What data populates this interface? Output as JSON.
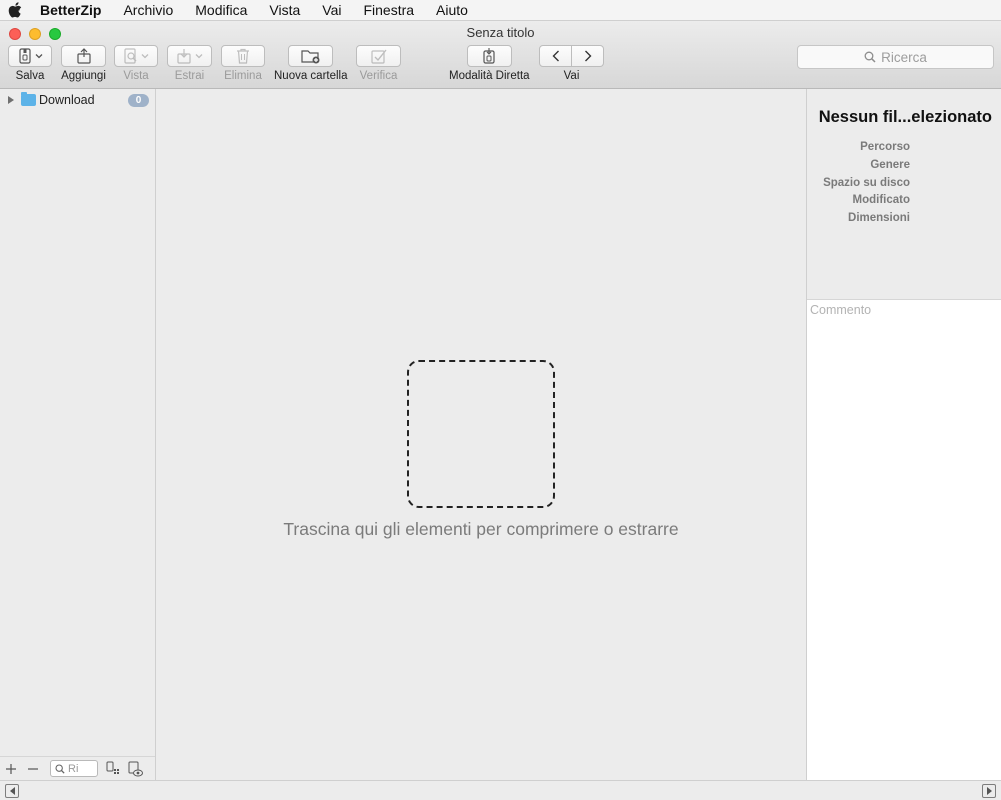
{
  "menubar": {
    "app_name": "BetterZip",
    "items": [
      "Archivio",
      "Modifica",
      "Vista",
      "Vai",
      "Finestra",
      "Aiuto"
    ]
  },
  "window": {
    "title": "Senza titolo"
  },
  "toolbar": {
    "salva": "Salva",
    "aggiungi": "Aggiungi",
    "vista": "Vista",
    "estrai": "Estrai",
    "elimina": "Elimina",
    "nuova_cartella": "Nuova cartella",
    "verifica": "Verifica",
    "modalita_diretta": "Modalità Diretta",
    "vai": "Vai",
    "search_placeholder": "Ricerca"
  },
  "sidebar": {
    "items": [
      {
        "label": "Download",
        "count": "0"
      }
    ],
    "filter_placeholder": "Ri"
  },
  "main": {
    "drop_hint": "Trascina qui gli elementi per comprimere o estrarre"
  },
  "inspector": {
    "title": "Nessun fil...elezionato",
    "labels": [
      "Percorso",
      "Genere",
      "Spazio su disco",
      "Modificato",
      "Dimensioni"
    ],
    "comment_placeholder": "Commento"
  },
  "colors": {
    "close": "#fc5f57",
    "minimize": "#fdbc2e",
    "zoom": "#28c840",
    "folder": "#5db3e8",
    "badge": "#9fb2c9"
  }
}
